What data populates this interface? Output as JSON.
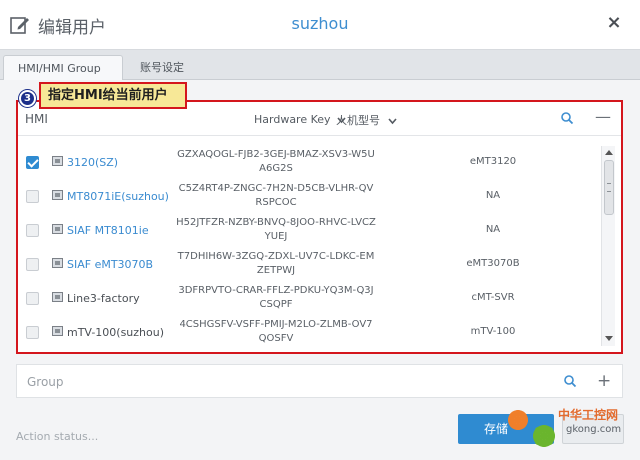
{
  "dialog": {
    "title": "编辑用户",
    "server_name": "suzhou"
  },
  "tabs": [
    {
      "label": "HMI/HMI Group",
      "active": true
    },
    {
      "label": "账号设定",
      "active": false
    }
  ],
  "callout": {
    "badge_number": "3",
    "text": "指定HMI给当前用户"
  },
  "hmi_panel": {
    "header_hmi": "HMI",
    "header_key": "Hardware Key",
    "header_model": "人机型号",
    "rows": [
      {
        "name": "3120(SZ)",
        "key": "GZXAQOGL-FJB2-3GEJ-BMAZ-XSV3-W5UA6G2S",
        "model": "eMT3120",
        "checked": true,
        "link": true
      },
      {
        "name": "MT8071iE(suzhou)",
        "key": "C5Z4RT4P-ZNGC-7H2N-D5CB-VLHR-QVRSPCOC",
        "model": "NA",
        "checked": false,
        "link": true
      },
      {
        "name": "SIAF MT8101ie",
        "key": "H52JTFZR-NZBY-BNVQ-8JOO-RHVC-LVCZYUEJ",
        "model": "NA",
        "checked": false,
        "link": true
      },
      {
        "name": "SIAF eMT3070B",
        "key": "T7DHIH6W-3ZGQ-ZDXL-UV7C-LDKC-EMZETPWJ",
        "model": "eMT3070B",
        "checked": false,
        "link": true
      },
      {
        "name": "Line3-factory",
        "key": "3DFRPVTO-CRAR-FFLZ-PDKU-YQ3M-Q3JCSQPF",
        "model": "cMT-SVR",
        "checked": false,
        "link": false
      },
      {
        "name": "mTV-100(suzhou)",
        "key": "4CSHGSFV-VSFF-PMIJ-M2LO-ZLMB-OV7QOSFV",
        "model": "mTV-100",
        "checked": false,
        "link": false
      }
    ]
  },
  "group_bar": {
    "label": "Group"
  },
  "footer": {
    "status": "Action status...",
    "save_label": "存储"
  },
  "watermark": {
    "line1": "中华工控网",
    "line2": "gkong.com"
  },
  "colors": {
    "accent": "#2f8bd1",
    "highlight_border": "#d4161d",
    "callout_bg": "#f7e897"
  }
}
